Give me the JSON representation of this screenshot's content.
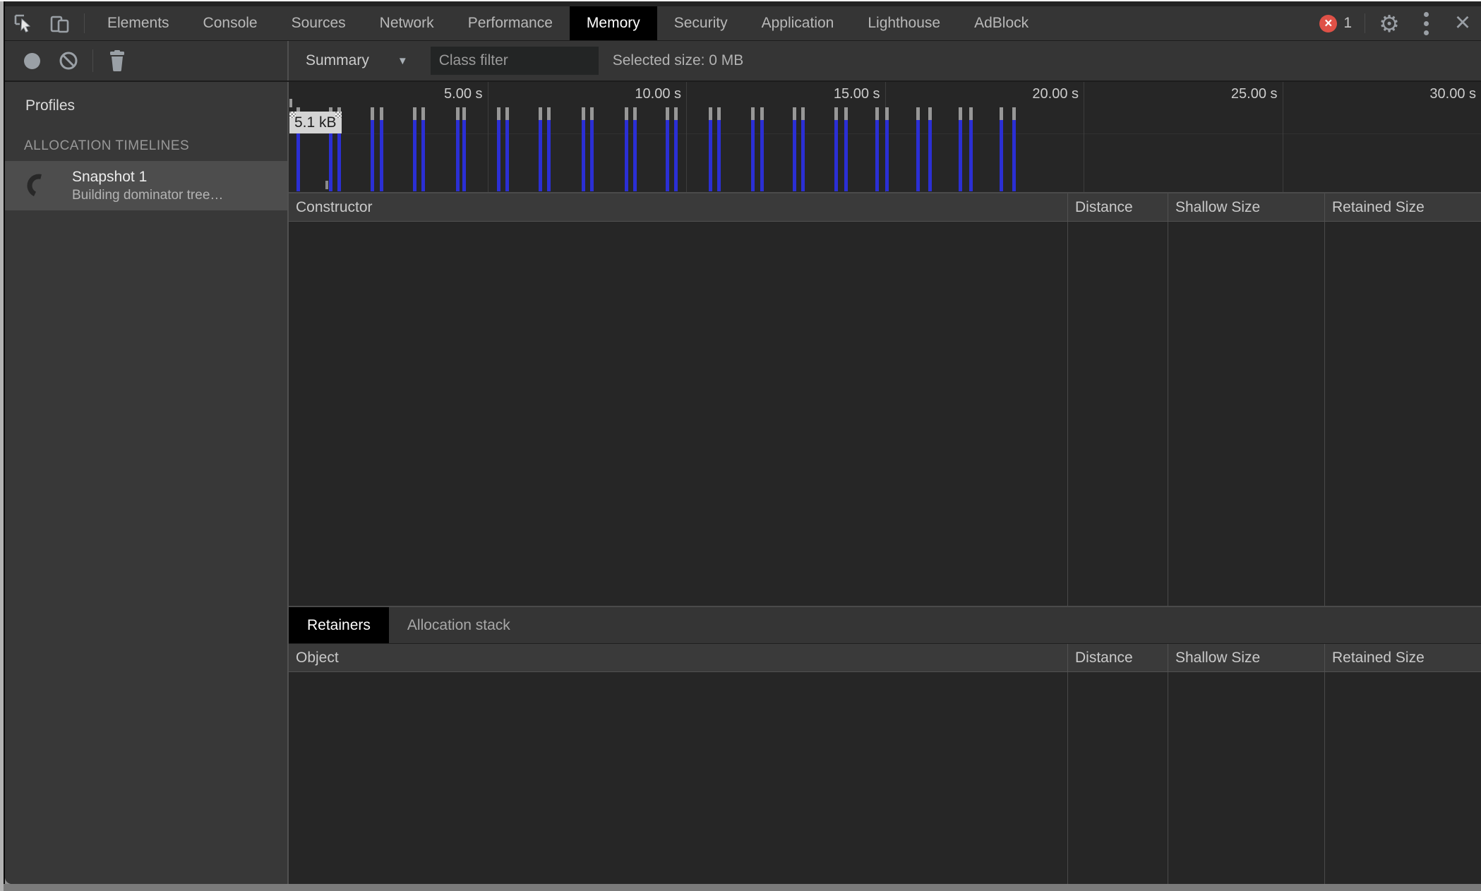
{
  "tabbar": {
    "tabs": [
      {
        "label": "Elements"
      },
      {
        "label": "Console"
      },
      {
        "label": "Sources"
      },
      {
        "label": "Network"
      },
      {
        "label": "Performance"
      },
      {
        "label": "Memory"
      },
      {
        "label": "Security"
      },
      {
        "label": "Application"
      },
      {
        "label": "Lighthouse"
      },
      {
        "label": "AdBlock"
      }
    ],
    "active_tab": "Memory",
    "error_count": "1",
    "error_icon": "×",
    "gear_icon": "⚙",
    "close_icon": "×"
  },
  "toolbar": {
    "summary_label": "Summary",
    "class_filter_placeholder": "Class filter",
    "selected_size": "Selected size: 0 MB"
  },
  "sidebar": {
    "profiles_label": "Profiles",
    "section_label": "ALLOCATION TIMELINES",
    "snapshot": {
      "title": "Snapshot 1",
      "status": "Building dominator tree…"
    }
  },
  "timeline": {
    "axis_max_s": 30,
    "ticks": [
      {
        "s": 5,
        "label": "5.00 s"
      },
      {
        "s": 10,
        "label": "10.00 s"
      },
      {
        "s": 15,
        "label": "15.00 s"
      },
      {
        "s": 20,
        "label": "20.00 s"
      },
      {
        "s": 25,
        "label": "25.00 s"
      },
      {
        "s": 30,
        "label": "30.00 s"
      }
    ],
    "selection_label": "5.1 kB",
    "bars_seconds": [
      0.23,
      1.05,
      1.26,
      2.09,
      2.32,
      3.16,
      3.37,
      4.24,
      4.41,
      5.27,
      5.48,
      6.33,
      6.54,
      7.41,
      7.62,
      8.49,
      8.71,
      9.52,
      9.73,
      10.6,
      10.82,
      11.67,
      11.9,
      12.71,
      12.93,
      13.76,
      14.01,
      14.79,
      15.04,
      15.83,
      16.12,
      16.9,
      17.15,
      17.93,
      18.25
    ],
    "bar_color": "#2b2fd4",
    "bar_cap_color": "#979797"
  },
  "tables": {
    "constructor_header": "Constructor",
    "object_header": "Object",
    "columns": [
      "Distance",
      "Shallow Size",
      "Retained Size"
    ]
  },
  "retainers_tabs": {
    "active": "Retainers",
    "inactive": "Allocation stack"
  }
}
